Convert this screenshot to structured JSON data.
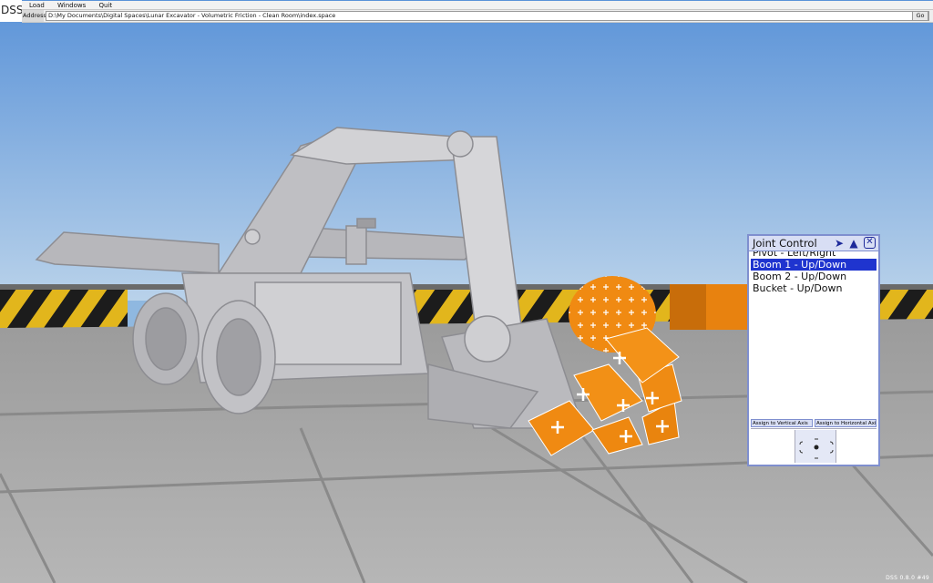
{
  "app": {
    "logo": "DSS"
  },
  "menu": {
    "items": [
      {
        "label": "Load"
      },
      {
        "label": "Windows"
      },
      {
        "label": "Quit"
      }
    ]
  },
  "address": {
    "label": "Address",
    "value": "D:\\My Documents\\Digital Spaces\\Lunar Excavator - Volumetric Friction - Clean Room\\index.space",
    "go_label": "Go"
  },
  "joint_control": {
    "title": "Joint Control",
    "next_icon": "chevron-right-icon",
    "up_icon": "chevron-up-icon",
    "close_icon": "close-icon",
    "items": [
      {
        "label": "Pivot - Left/Right"
      },
      {
        "label": "Boom 1 - Up/Down"
      },
      {
        "label": "Boom 2 - Up/Down"
      },
      {
        "label": "Bucket - Up/Down"
      }
    ],
    "selected_index": 1,
    "assign_vertical": "Assign to Vertical Axis",
    "assign_horizontal": "Assign to Horizontal Axis"
  },
  "status": {
    "version": "DSS 0.8.0 #49"
  },
  "colors": {
    "sky_top": "#5b93d8",
    "sky_bottom": "#b9d2ea",
    "floor": "#a9a9a9",
    "robot": "#c9c9cc",
    "orange": "#f08a12",
    "selection": "#1f34cf",
    "panel_border": "#7f8fcf"
  }
}
